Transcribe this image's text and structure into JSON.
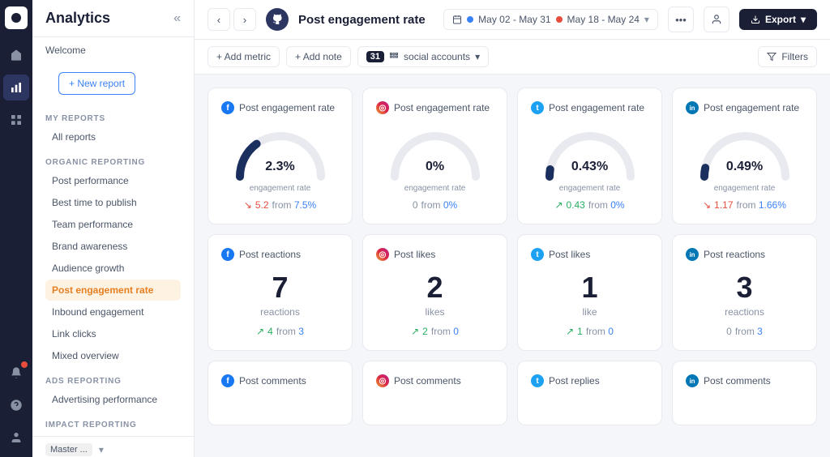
{
  "app": {
    "title": "Analytics"
  },
  "sidebar": {
    "collapse_icon": "«",
    "welcome_label": "Welcome",
    "new_report_label": "+ New report",
    "sections": [
      {
        "id": "my-reports",
        "label": "MY REPORTS",
        "items": [
          {
            "id": "all-reports",
            "label": "All reports",
            "active": false
          }
        ]
      },
      {
        "id": "organic-reporting",
        "label": "ORGANIC REPORTING",
        "items": [
          {
            "id": "post-performance",
            "label": "Post performance",
            "active": false
          },
          {
            "id": "best-time",
            "label": "Best time to publish",
            "active": false
          },
          {
            "id": "team-performance",
            "label": "Team performance",
            "active": false
          },
          {
            "id": "brand-awareness",
            "label": "Brand awareness",
            "active": false
          },
          {
            "id": "audience-growth",
            "label": "Audience growth",
            "active": false
          },
          {
            "id": "post-engagement-rate",
            "label": "Post engagement rate",
            "active": true
          },
          {
            "id": "inbound-engagement",
            "label": "Inbound engagement",
            "active": false
          },
          {
            "id": "link-clicks",
            "label": "Link clicks",
            "active": false
          },
          {
            "id": "mixed-overview",
            "label": "Mixed overview",
            "active": false
          }
        ]
      },
      {
        "id": "ads-reporting",
        "label": "ADS REPORTING",
        "items": [
          {
            "id": "advertising-performance",
            "label": "Advertising performance",
            "active": false
          }
        ]
      },
      {
        "id": "impact-reporting",
        "label": "IMPACT REPORTING",
        "items": []
      }
    ],
    "footer": {
      "master_label": "Master ...",
      "chevron": "▾"
    }
  },
  "topbar": {
    "title": "Post engagement rate",
    "back_icon": "‹",
    "forward_icon": "›",
    "date_range_1": "May 02 - May 31",
    "date_range_2": "May 18 - May 24",
    "export_label": "Export"
  },
  "toolbar": {
    "add_metric_label": "+ Add metric",
    "add_note_label": "+ Add note",
    "social_accounts_count": "31",
    "social_accounts_label": "social accounts",
    "filters_label": "Filters"
  },
  "rows": [
    {
      "id": "row-engagement",
      "cards": [
        {
          "platform": "fb",
          "platform_symbol": "f",
          "title": "Post engagement rate",
          "type": "gauge",
          "value": "2.3%",
          "label": "engagement rate",
          "change_dir": "down",
          "change_val": "5.2",
          "change_from": "7.5%",
          "gauge_fill": 0.3
        },
        {
          "platform": "ig",
          "platform_symbol": "◎",
          "title": "Post engagement rate",
          "type": "gauge",
          "value": "0%",
          "label": "engagement rate",
          "change_dir": "neutral",
          "change_val": "0",
          "change_from": "0%",
          "gauge_fill": 0
        },
        {
          "platform": "tw",
          "platform_symbol": "t",
          "title": "Post engagement rate",
          "type": "gauge",
          "value": "0.43%",
          "label": "engagement rate",
          "change_dir": "up",
          "change_val": "0.43",
          "change_from": "0%",
          "gauge_fill": 0.06
        },
        {
          "platform": "li",
          "platform_symbol": "in",
          "title": "Post engagement rate",
          "type": "gauge",
          "value": "0.49%",
          "label": "engagement rate",
          "change_dir": "down",
          "change_val": "1.17",
          "change_from": "1.66%",
          "gauge_fill": 0.07
        }
      ]
    },
    {
      "id": "row-reactions",
      "cards": [
        {
          "platform": "fb",
          "platform_symbol": "f",
          "title": "Post reactions",
          "type": "number",
          "value": "7",
          "unit": "reactions",
          "change_dir": "up",
          "change_val": "4",
          "change_from": "3"
        },
        {
          "platform": "ig",
          "platform_symbol": "◎",
          "title": "Post likes",
          "type": "number",
          "value": "2",
          "unit": "likes",
          "change_dir": "up",
          "change_val": "2",
          "change_from": "0"
        },
        {
          "platform": "tw",
          "platform_symbol": "t",
          "title": "Post likes",
          "type": "number",
          "value": "1",
          "unit": "like",
          "change_dir": "up",
          "change_val": "1",
          "change_from": "0"
        },
        {
          "platform": "li",
          "platform_symbol": "in",
          "title": "Post reactions",
          "type": "number",
          "value": "3",
          "unit": "reactions",
          "change_dir": "neutral",
          "change_val": "0",
          "change_from": "3"
        }
      ]
    },
    {
      "id": "row-comments",
      "cards": [
        {
          "platform": "fb",
          "platform_symbol": "f",
          "title": "Post comments",
          "type": "number",
          "value": "",
          "unit": "",
          "change_dir": "neutral",
          "change_val": "",
          "change_from": ""
        },
        {
          "platform": "ig",
          "platform_symbol": "◎",
          "title": "Post comments",
          "type": "number",
          "value": "",
          "unit": "",
          "change_dir": "neutral",
          "change_val": "",
          "change_from": ""
        },
        {
          "platform": "tw",
          "platform_symbol": "t",
          "title": "Post replies",
          "type": "number",
          "value": "",
          "unit": "",
          "change_dir": "neutral",
          "change_val": "",
          "change_from": ""
        },
        {
          "platform": "li",
          "platform_symbol": "in",
          "title": "Post comments",
          "type": "number",
          "value": "",
          "unit": "",
          "change_dir": "neutral",
          "change_val": "",
          "change_from": ""
        }
      ]
    }
  ]
}
